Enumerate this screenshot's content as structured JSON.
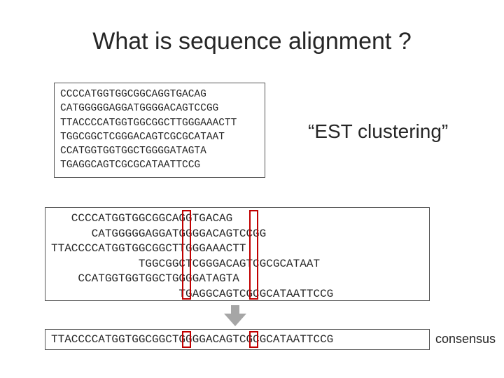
{
  "title": "What is sequence alignment ?",
  "box1": {
    "lines": [
      "CCCCATGGTGGCGGCAGGTGACAG",
      "CATGGGGGAGGATGGGGACAGTCCGG",
      "TTACCCCATGGTGGCGGCTTGGGAAACTT",
      "TGGCGGCTCGGGACAGTCGCGCATAAT",
      "CCATGGTGGTGGCTGGGGATAGTA",
      "TGAGGCAGTCGCGCATAATTCCG"
    ]
  },
  "label_est": "“EST clustering”",
  "box2": {
    "lines": [
      "   CCCCATGGTGGCGGCAGGTGACAG",
      "      CATGGGGGAGGATGGGGACAGTCCGG",
      "TTACCCCATGGTGGCGGCTTGGGAAACTT",
      "             TGGCGGCTCGGGACAGTCGCGCATAAT",
      "    CCATGGTGGTGGCTGGGGATAGTA",
      "                   TGAGGCAGTCGCGCATAATTCCG"
    ]
  },
  "box3": {
    "text": "TTACCCCATGGTGGCGGCTGGGGACAGTCGCGCATAATTCCG"
  },
  "label_consensus": "consensus"
}
